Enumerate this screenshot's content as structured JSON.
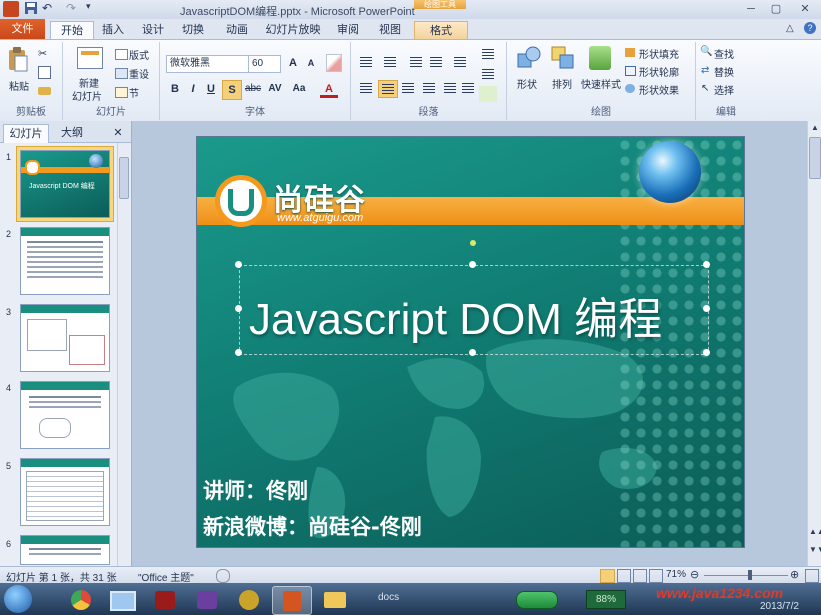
{
  "window": {
    "title": "JavascriptDOM编程.pptx - Microsoft PowerPoint",
    "context_tab_group": "绘图工具"
  },
  "tabs": [
    "文件",
    "开始",
    "插入",
    "设计",
    "切换",
    "动画",
    "幻灯片放映",
    "审阅",
    "视图",
    "格式"
  ],
  "ribbon": {
    "clipboard": {
      "paste": "粘贴",
      "group": "剪贴板"
    },
    "slides": {
      "new_slide": "新建",
      "new_slide_2": "幻灯片",
      "layout": "版式",
      "reset": "重设",
      "section": "节",
      "group": "幻灯片"
    },
    "font": {
      "family": "微软雅黑",
      "size": "60",
      "bold": "B",
      "italic": "I",
      "underline": "U",
      "shadow": "S",
      "strike": "abc",
      "spacing": "AV",
      "case": "Aa",
      "color": "A",
      "grow": "A",
      "shrink": "A",
      "group": "字体"
    },
    "paragraph": {
      "group": "段落"
    },
    "drawing": {
      "shapes": "形状",
      "arrange": "排列",
      "quick_styles": "快速样式",
      "fill": "形状填充",
      "outline": "形状轮廓",
      "effects": "形状效果",
      "group": "绘图"
    },
    "editing": {
      "find": "查找",
      "replace": "替换",
      "select": "选择",
      "group": "编辑"
    }
  },
  "left_pane": {
    "tab_slides": "幻灯片",
    "tab_outline": "大纲",
    "close": "✕",
    "thumbnails": [
      {
        "num": "1",
        "title": "Javascript DOM 编程"
      },
      {
        "num": "2"
      },
      {
        "num": "3"
      },
      {
        "num": "4"
      },
      {
        "num": "5"
      },
      {
        "num": "6"
      }
    ]
  },
  "slide": {
    "logo_text": "尚硅谷",
    "logo_url": "www.atguigu.com",
    "title": "Javascript DOM 编程",
    "lecturer": "讲师：佟刚",
    "weibo": "新浪微博：尚硅谷-佟刚"
  },
  "status": {
    "slide_info": "幻灯片 第 1 张，共 31 张",
    "theme": "\"Office 主题\"",
    "zoom": "71%"
  },
  "taskbar": {
    "docs_label": "docs",
    "battery": "88%",
    "watermark": "www.java1234.com",
    "date": "2013/7/2"
  },
  "colors": {
    "slide_teal": "#117e74",
    "banner_orange": "#f39a1e",
    "file_tab": "#d4551f"
  }
}
